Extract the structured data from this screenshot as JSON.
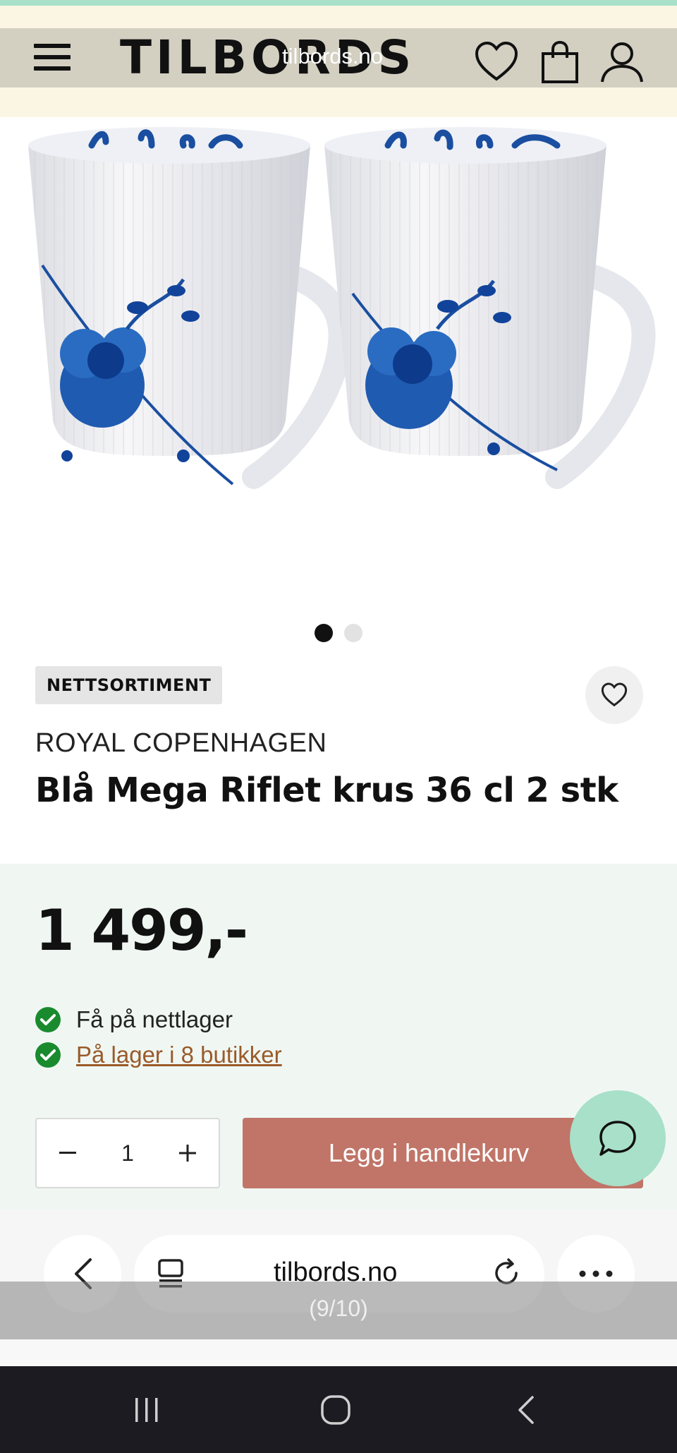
{
  "header": {
    "logo": "TILBORDS",
    "watermark": "tilbords.no",
    "icons": [
      "menu-icon",
      "heart-icon",
      "bag-icon",
      "user-icon"
    ]
  },
  "gallery": {
    "slides_total": 2,
    "active_slide": 1
  },
  "product": {
    "badge": "NETTSORTIMENT",
    "brand": "ROYAL COPENHAGEN",
    "title": "Blå Mega Riflet krus 36 cl 2 stk",
    "price": "1 499,-",
    "availability": {
      "online": "Få på nettlager",
      "stores": "På lager i 8 butikker"
    },
    "quantity": "1",
    "add_to_cart": "Legg i handlekurv"
  },
  "browser": {
    "url": "tilbords.no",
    "counter": "(9/10)"
  },
  "colors": {
    "accent_mint": "#a8e0c9",
    "cart_button": "#c07568",
    "price_panel": "#f0f7f3",
    "stock_check": "#1a8a2e",
    "link_brown": "#9a5a2a"
  }
}
